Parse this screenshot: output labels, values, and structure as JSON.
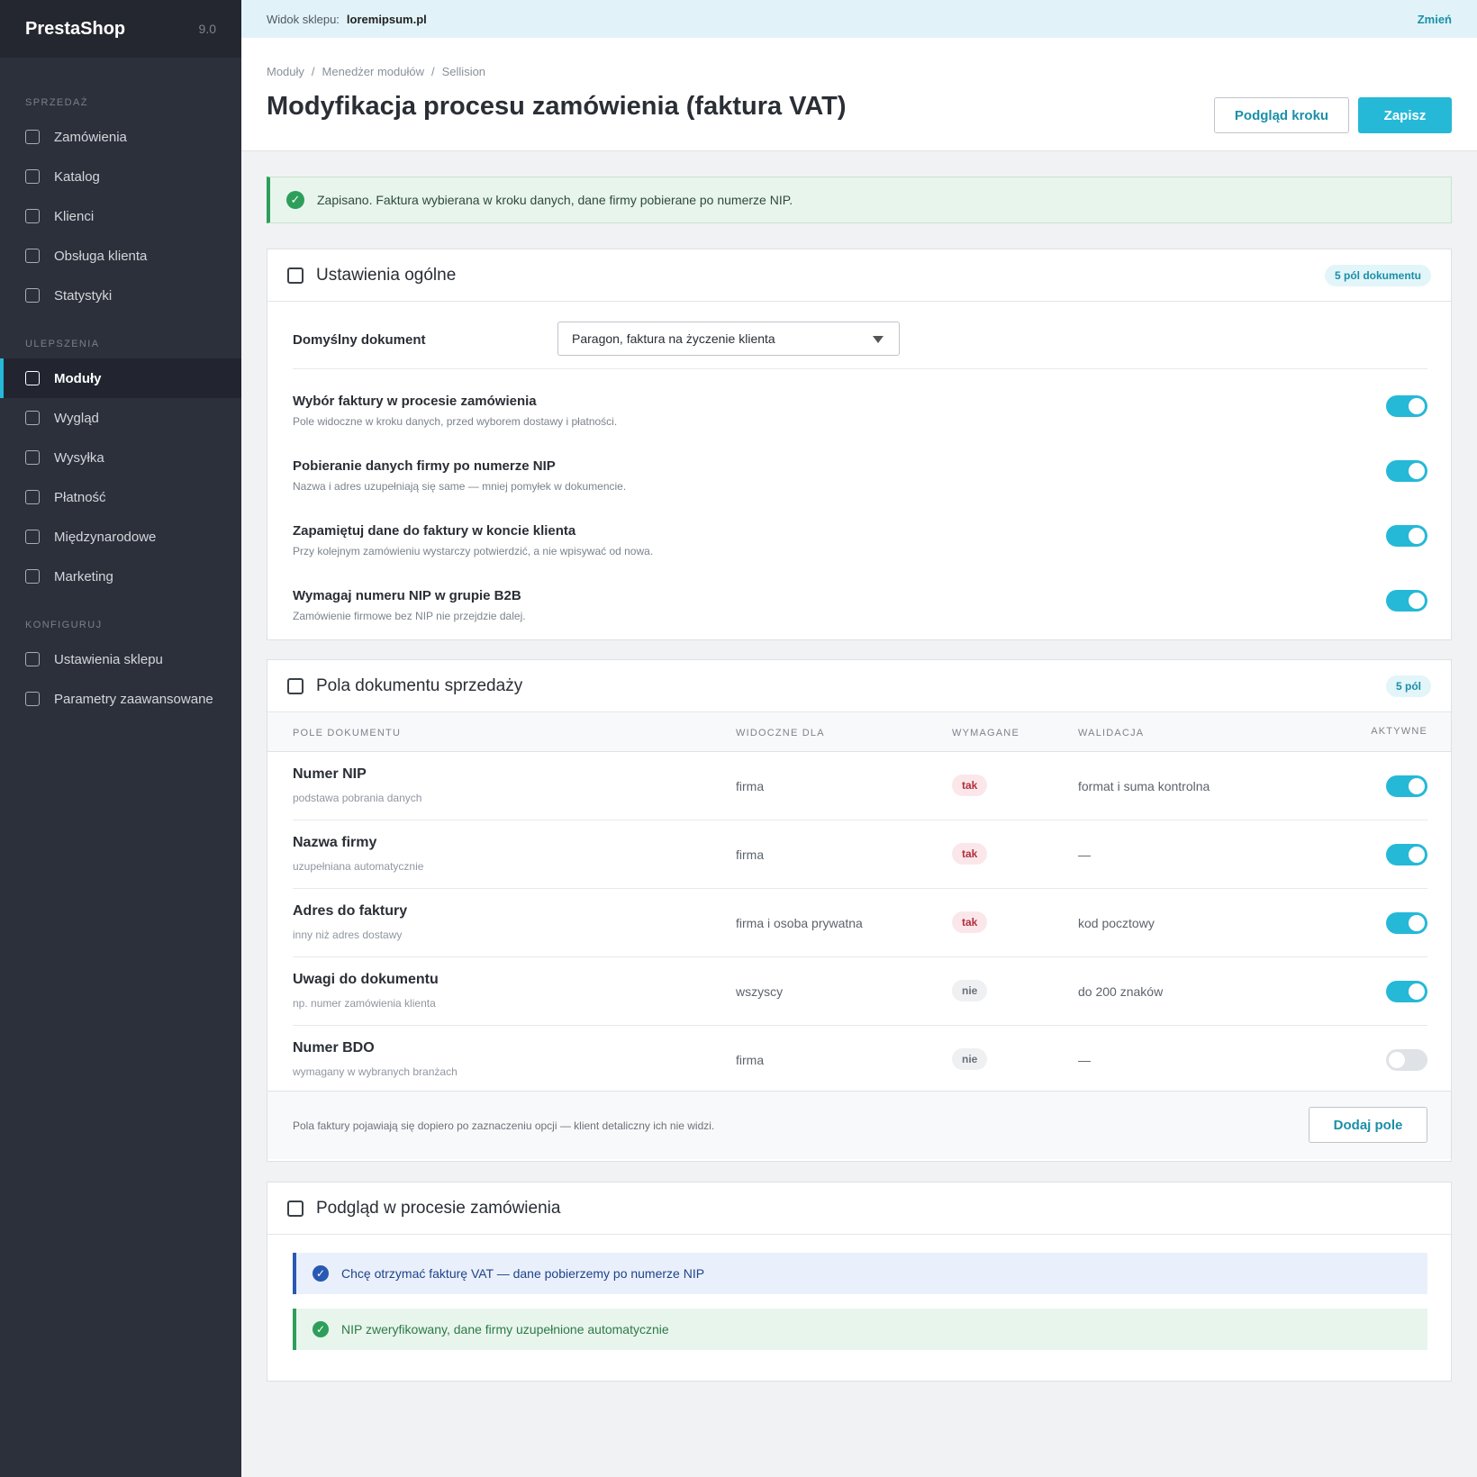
{
  "sidebar": {
    "brand": "PrestaShop",
    "version": "9.0",
    "sections": [
      {
        "title": "SPRZEDAŻ",
        "items": [
          "Zamówienia",
          "Katalog",
          "Klienci",
          "Obsługa klienta",
          "Statystyki"
        ]
      },
      {
        "title": "ULEPSZENIA",
        "items": [
          "Moduły",
          "Wygląd",
          "Wysyłka",
          "Płatność",
          "Międzynarodowe",
          "Marketing"
        ]
      },
      {
        "title": "KONFIGURUJ",
        "items": [
          "Ustawienia sklepu",
          "Parametry zaawansowane"
        ]
      }
    ],
    "active_item": "Moduły"
  },
  "storebar": {
    "label": "Widok sklepu:",
    "url": "loremipsum.pl",
    "change": "Zmień"
  },
  "header": {
    "breadcrumbs": [
      "Moduły",
      "Menedżer modułów",
      "Sellision"
    ],
    "title": "Modyfikacja procesu zamówienia (faktura VAT)",
    "preview_button": "Podgląd kroku",
    "save_button": "Zapisz"
  },
  "alert": {
    "text": "Zapisano. Faktura wybierana w kroku danych, dane firmy pobierane po numerze NIP."
  },
  "general": {
    "title": "Ustawienia ogólne",
    "badge": "5 pól dokumentu",
    "default_doc_label": "Domyślny dokument",
    "default_doc_value": "Paragon, faktura na życzenie klienta",
    "options": [
      {
        "title": "Wybór faktury w procesie zamówienia",
        "desc": "Pole widoczne w kroku danych, przed wyborem dostawy i płatności.",
        "on": true
      },
      {
        "title": "Pobieranie danych firmy po numerze NIP",
        "desc": "Nazwa i adres uzupełniają się same — mniej pomyłek w dokumencie.",
        "on": true
      },
      {
        "title": "Zapamiętuj dane do faktury w koncie klienta",
        "desc": "Przy kolejnym zamówieniu wystarczy potwierdzić, a nie wpisywać od nowa.",
        "on": true
      },
      {
        "title": "Wymagaj numeru NIP w grupie B2B",
        "desc": "Zamówienie firmowe bez NIP nie przejdzie dalej.",
        "on": true
      }
    ]
  },
  "fields": {
    "title": "Pola dokumentu sprzedaży",
    "badge": "5 pól",
    "columns": [
      "POLE DOKUMENTU",
      "WIDOCZNE DLA",
      "WYMAGANE",
      "WALIDACJA",
      "AKTYWNE"
    ],
    "rows": [
      {
        "name": "Numer NIP",
        "sub": "podstawa pobrania danych",
        "visible": "firma",
        "required": "tak",
        "validation": "format i suma kontrolna",
        "active": true
      },
      {
        "name": "Nazwa firmy",
        "sub": "uzupełniana automatycznie",
        "visible": "firma",
        "required": "tak",
        "validation": "—",
        "active": true
      },
      {
        "name": "Adres do faktury",
        "sub": "inny niż adres dostawy",
        "visible": "firma i osoba prywatna",
        "required": "tak",
        "validation": "kod pocztowy",
        "active": true
      },
      {
        "name": "Uwagi do dokumentu",
        "sub": "np. numer zamówienia klienta",
        "visible": "wszyscy",
        "required": "nie",
        "validation": "do 200 znaków",
        "active": true
      },
      {
        "name": "Numer BDO",
        "sub": "wymagany w wybranych branżach",
        "visible": "firma",
        "required": "nie",
        "validation": "—",
        "active": false
      }
    ],
    "footer_note": "Pola faktury pojawiają się dopiero po zaznaczeniu opcji — klient detaliczny ich nie widzi.",
    "add_button": "Dodaj pole"
  },
  "preview": {
    "title": "Podgląd w procesie zamówienia",
    "info": "Chcę otrzymać fakturę VAT — dane pobierzemy po numerze NIP",
    "success": "NIP zweryfikowany, dane firmy uzupełnione automatycznie"
  },
  "colors": {
    "accent": "#25b9d7",
    "sidebar": "#2c303a",
    "success": "#2e9e5b",
    "info": "#2859b3",
    "danger": "#b0303e"
  }
}
